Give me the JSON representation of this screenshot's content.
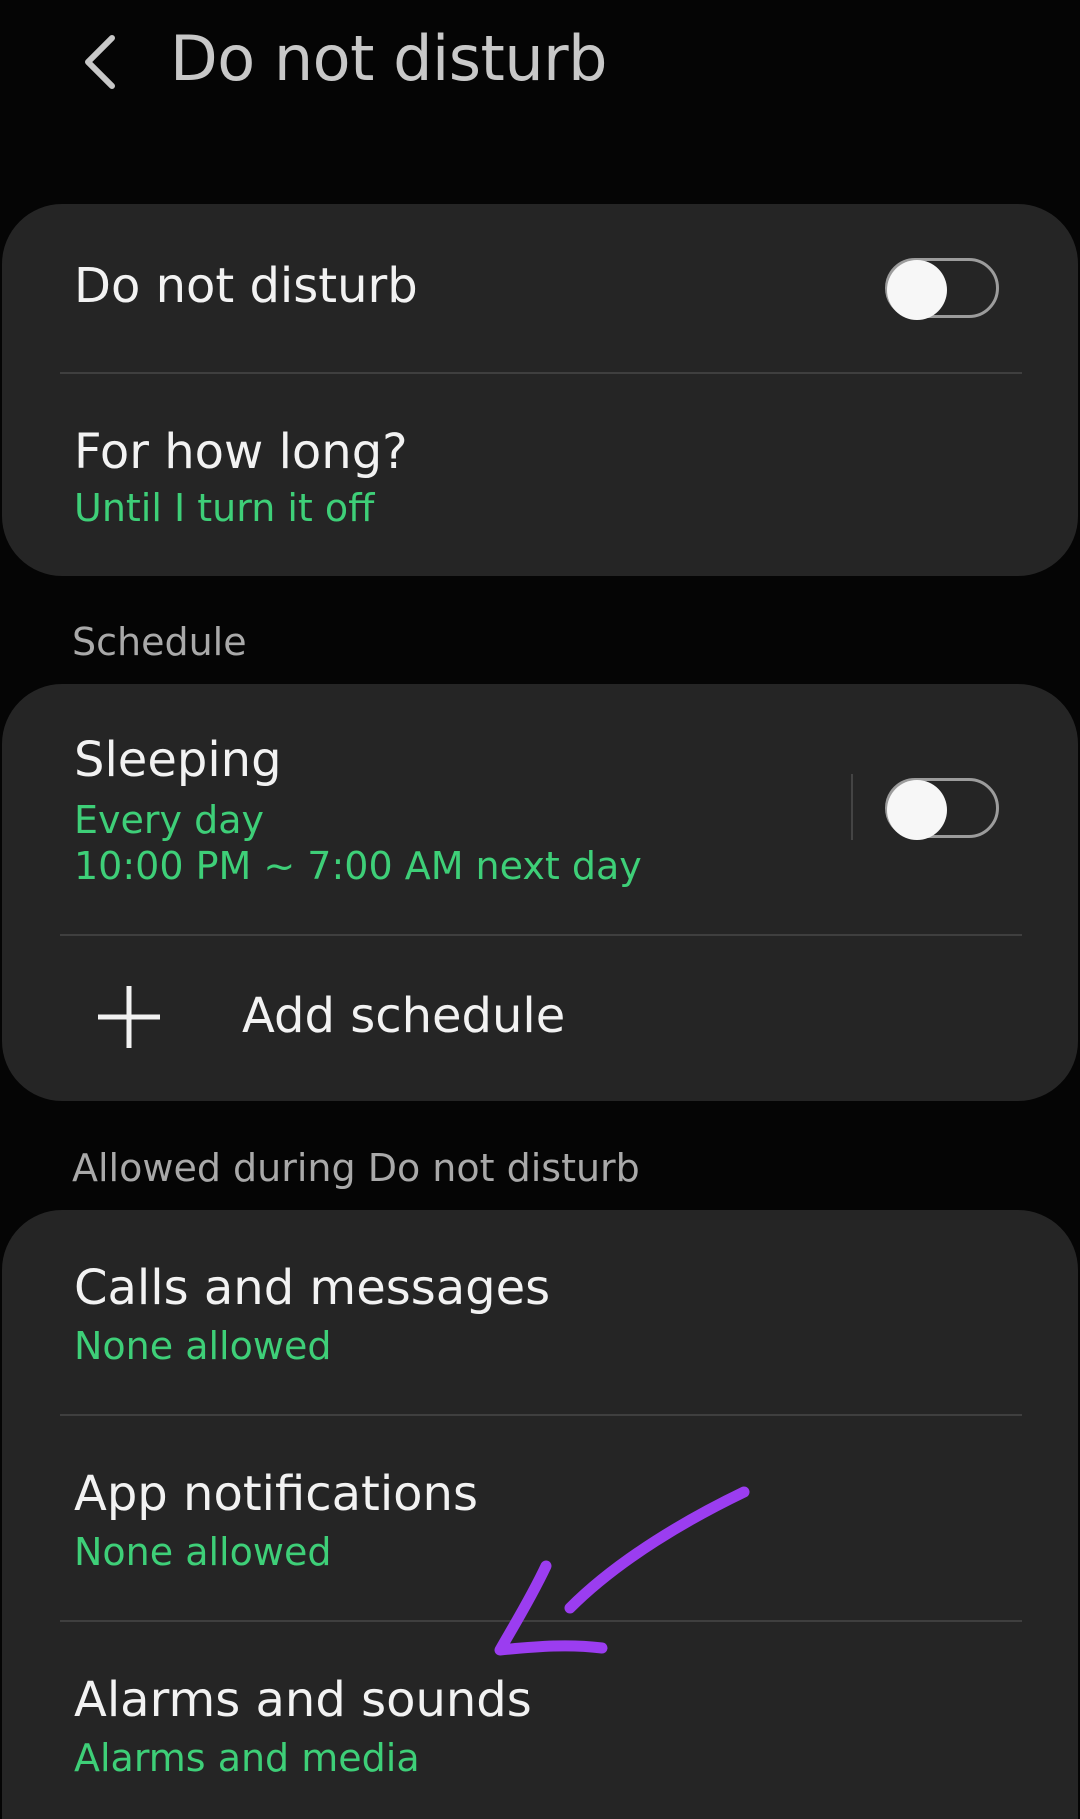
{
  "header": {
    "back_icon": "chevron-left-icon",
    "title": "Do not disturb"
  },
  "main_card": {
    "dnd": {
      "label": "Do not disturb",
      "enabled": false
    },
    "duration": {
      "title": "For how long?",
      "value": "Until I turn it off"
    }
  },
  "schedule_section": {
    "header": "Schedule",
    "items": [
      {
        "title": "Sleeping",
        "days": "Every day",
        "time": "10:00 PM ~ 7:00 AM next day",
        "enabled": false
      }
    ],
    "add_label": "Add schedule",
    "add_icon": "plus-icon"
  },
  "allowed_section": {
    "header": "Allowed during Do not disturb",
    "items": [
      {
        "title": "Calls and messages",
        "value": "None allowed"
      },
      {
        "title": "App notifications",
        "value": "None allowed"
      },
      {
        "title": "Alarms and sounds",
        "value": "Alarms and media"
      }
    ]
  },
  "colors": {
    "background": "#050505",
    "card": "#252525",
    "accent_green": "#3ecf78",
    "annotation_purple": "#9b3df0"
  },
  "annotation": {
    "icon": "hand-drawn-arrow-icon"
  }
}
